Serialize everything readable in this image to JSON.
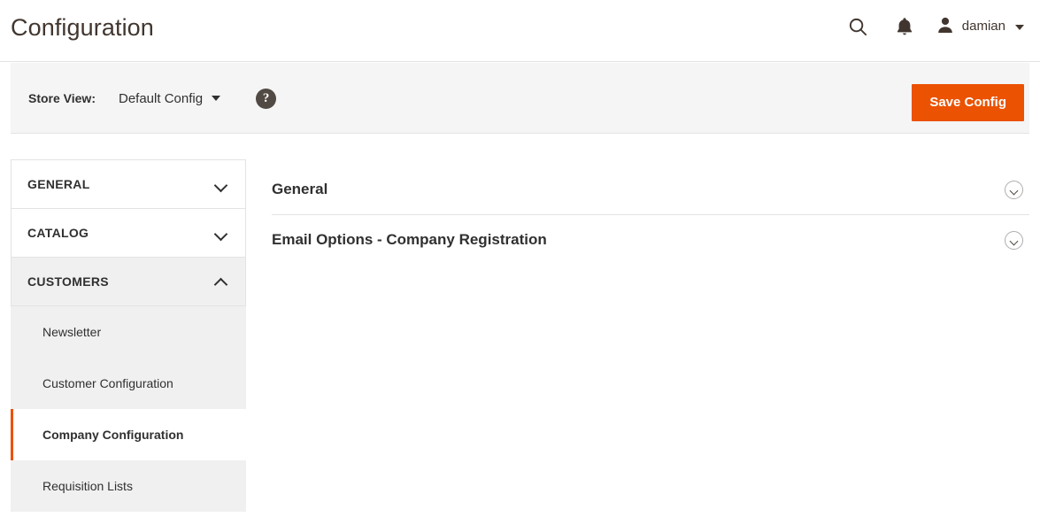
{
  "header": {
    "title": "Configuration",
    "search_icon": "search-icon",
    "notifications_icon": "bell-icon",
    "avatar_icon": "user-avatar-icon",
    "user_name": "damian",
    "caret_icon": "chevron-down-icon"
  },
  "store_bar": {
    "label": "Store View:",
    "selected_scope": "Default Config",
    "scope_caret_icon": "chevron-down-icon",
    "help_icon": "question-mark-icon",
    "help_glyph": "?",
    "save_button": "Save Config"
  },
  "sidebar": {
    "sections": [
      {
        "label": "GENERAL",
        "expanded": false,
        "chevron_icon": "chevron-down-icon"
      },
      {
        "label": "CATALOG",
        "expanded": false,
        "chevron_icon": "chevron-down-icon"
      },
      {
        "label": "CUSTOMERS",
        "expanded": true,
        "chevron_icon": "chevron-up-icon"
      }
    ],
    "sub_items": [
      {
        "label": "Newsletter",
        "active": false
      },
      {
        "label": "Customer Configuration",
        "active": false
      },
      {
        "label": "Company Configuration",
        "active": true
      },
      {
        "label": "Requisition Lists",
        "active": false
      }
    ]
  },
  "main": {
    "fieldsets": [
      {
        "title": "General",
        "collapsed": true,
        "toggle_icon": "chevron-down-circle-icon"
      },
      {
        "title": "Email Options - Company Registration",
        "collapsed": true,
        "toggle_icon": "chevron-down-circle-icon"
      }
    ]
  },
  "colors": {
    "accent": "#eb5202",
    "text": "#303030",
    "title": "#41362f",
    "panel_bg": "#f5f5f5",
    "border": "#e3e3e3"
  }
}
